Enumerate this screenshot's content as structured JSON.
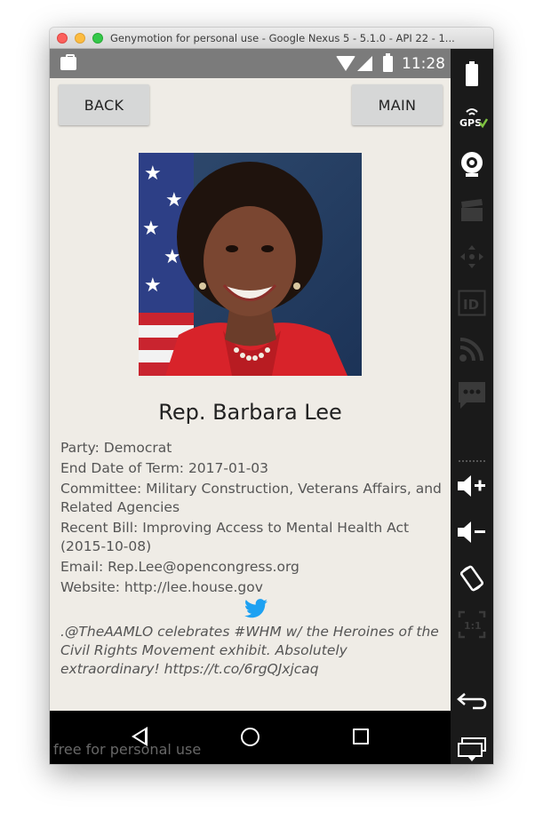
{
  "window": {
    "title": "Genymotion for personal use - Google Nexus 5 - 5.1.0 - API 22 - 1..."
  },
  "status_bar": {
    "time": "11:28",
    "icons": [
      "notification-bag-icon",
      "wifi-icon",
      "cell-signal-icon",
      "battery-icon"
    ]
  },
  "app": {
    "back_label": "BACK",
    "main_label": "MAIN",
    "name": "Rep. Barbara Lee",
    "party": "Party: Democrat",
    "end_date": "End Date of Term: 2017-01-03",
    "committee": "Committee: Military Construction, Veterans Affairs, and Related Agencies",
    "recent_bill": "Recent Bill: Improving Access to Mental Health Act (2015-10-08)",
    "email": "Email: Rep.Lee@opencongress.org",
    "website": "Website: http://lee.house.gov",
    "tweet": ".@TheAAMLO celebrates #WHM w/ the Heroines of the Civil Rights Movement exhibit. Absolutely extraordinary! https://t.co/6rgQJxjcaq"
  },
  "nav_bar": {
    "icons": [
      "back-icon",
      "home-icon",
      "recents-icon"
    ],
    "watermark": "free for personal use"
  },
  "toolbar": {
    "icons": [
      "battery-icon",
      "gps-icon",
      "webcam-icon",
      "capture-icon",
      "remote-control-icon",
      "device-id-icon",
      "network-icon",
      "sms-icon",
      "volume-up-icon",
      "volume-down-icon",
      "rotate-icon",
      "pixel-perfect-icon",
      "back-icon",
      "recent-apps-icon",
      "scroll-down-icon"
    ],
    "gps_label": "GPS",
    "id_label": "ID",
    "pixel_label": "1:1"
  }
}
